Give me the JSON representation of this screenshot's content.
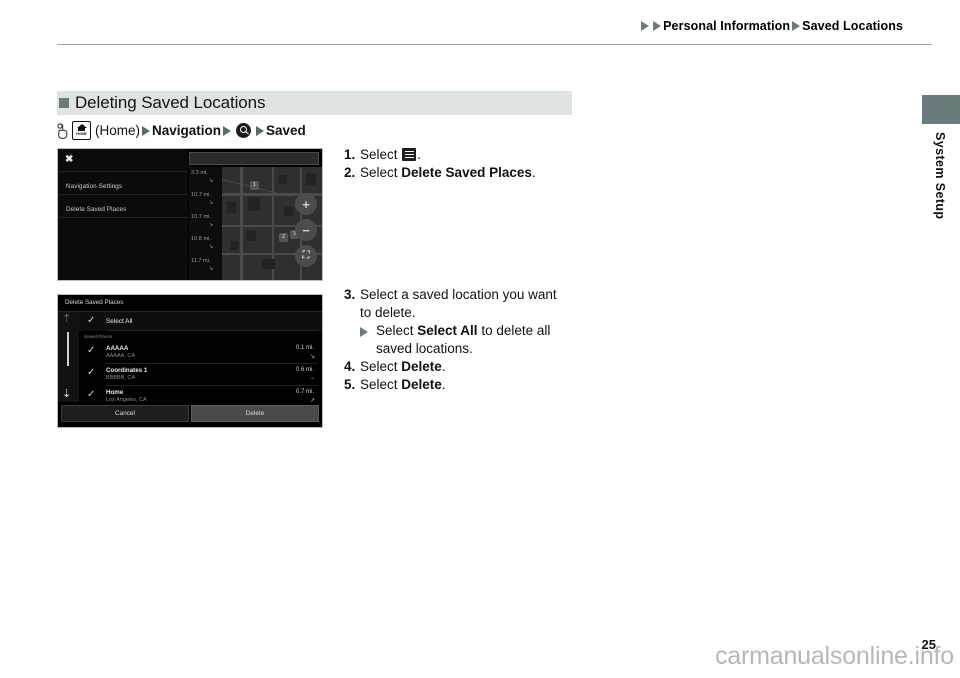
{
  "header": {
    "breadcrumb": {
      "arrow1": "play-triangle",
      "arrow2": "play-triangle",
      "item1": "Personal Information",
      "item2": "Saved Locations"
    }
  },
  "side": {
    "tab_label": "",
    "vertical_label": "System Setup"
  },
  "section": {
    "title": "Deleting Saved Locations"
  },
  "path": {
    "hand_icon": "hand-pointer-icon",
    "home_icon": "home-button-icon",
    "home_label": "HOME",
    "home_text": "(Home)",
    "nav": "Navigation",
    "search_icon": "search-icon",
    "saved": "Saved"
  },
  "shot1": {
    "close_icon": "close-x-icon",
    "menu_items": [
      "Navigation Settings",
      "Delete Saved Places"
    ],
    "distances": [
      "3.3 mi.",
      "10.7 mi.",
      "10.7 mi.",
      "10.8 mi.",
      "11.7 mi."
    ],
    "map_buttons": [
      "zoom-in-icon",
      "zoom-out-icon",
      "expand-icon"
    ],
    "map_pins": [
      "1",
      "2",
      "3"
    ]
  },
  "shot2": {
    "title": "Delete Saved Places",
    "select_all": "Select All",
    "group_label": "Saved Places",
    "rows": [
      {
        "name": "AAAAA",
        "sub": "AAAAA, CA",
        "dist": "0.1 mi.",
        "dir": "↘"
      },
      {
        "name": "Coordinates 1",
        "sub": "BBBBB, CA",
        "dist": "0.6 mi.",
        "dir": "→"
      },
      {
        "name": "Home",
        "sub": "Los Angeles, CA",
        "dist": "0.7 mi.",
        "dir": "↗"
      }
    ],
    "cancel_label": "Cancel",
    "delete_label": "Delete",
    "check_glyph": "✓",
    "scroll_up_glyph": "⤒",
    "scroll_down_glyph": "⤓"
  },
  "instructions": {
    "step1_num": "1.",
    "step1_pre": "Select",
    "step1_icon": "hamburger-menu-icon",
    "step1_post": ".",
    "step2_num": "2.",
    "step2_pre": "Select ",
    "step2_bold": "Delete Saved Places",
    "step2_post": ".",
    "step3_num": "3.",
    "step3_line1": "Select a saved location you want",
    "step3_line2": "to delete.",
    "step3_sub_pre": "Select ",
    "step3_sub_bold": "Select All",
    "step3_sub_mid": " to delete all",
    "step3_sub_line2": "saved locations.",
    "step4_num": "4.",
    "step4_pre": "Select ",
    "step4_bold": "Delete",
    "step4_post": ".",
    "step5_num": "5.",
    "step5_pre": "Select ",
    "step5_bold": "Delete",
    "step5_post": "."
  },
  "footer": {
    "watermark": "carmanualsonline.info",
    "page_number": "25"
  },
  "colors": {
    "accent": "#6b7a7a",
    "section_bar": "#dfe3e1",
    "rule": "#9ba5a5"
  }
}
